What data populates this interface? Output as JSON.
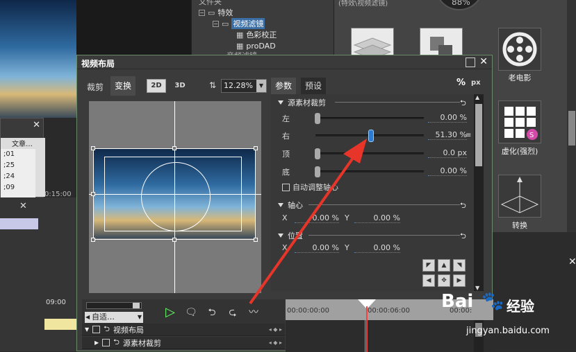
{
  "tree": {
    "root_partial": "文件夹",
    "effects": "特效",
    "video_filters": "视频滤镜",
    "color_correction": "色彩校正",
    "prodad": "proDAD",
    "cut_item": "音频滤镜"
  },
  "right_panel": {
    "header_partial": "(特效\\视频滤镜)",
    "gauge_partial": "88%",
    "tiles": [
      {
        "label": "老电影",
        "icon": "film-reel-icon"
      },
      {
        "label": "虚化(强烈)",
        "icon": "grid-blur-icon"
      },
      {
        "label": "转换",
        "icon": "3d-grid-icon"
      }
    ]
  },
  "small_dialog": {
    "header_partial": "文章…",
    "rows": [
      ";01",
      ";25",
      ";24",
      ";09"
    ]
  },
  "background_timeline": {
    "time1": "0:15:00",
    "time2": "09:00"
  },
  "dialog": {
    "title": "视频布局",
    "left_tabs": {
      "crop": "裁剪",
      "transform": "变换"
    },
    "mode_2d": "2D",
    "mode_3d": "3D",
    "zoom": "12.28%",
    "right_tabs": {
      "params": "参数",
      "preset": "预设"
    },
    "unit_pct": "%",
    "unit_px": "px",
    "source_crop": {
      "title": "源素材裁剪",
      "left_label": "左",
      "left_value": "0.00 %",
      "left_fraction": 0.02,
      "right_label": "右",
      "right_value": "51.30 %",
      "right_fraction": 0.513,
      "top_label": "顶",
      "top_value": "0.0 px",
      "top_fraction": 0.02,
      "bottom_label": "底",
      "bottom_value": "0.00 %",
      "bottom_fraction": 0.02,
      "auto_adjust": "自动调整轴心"
    },
    "pivot": {
      "title": "轴心",
      "x_label": "X",
      "x_value": "0.00 %",
      "y_label": "Y",
      "y_value": "0.00 %"
    },
    "position": {
      "title": "位置",
      "x_label": "X",
      "x_value": "0.00 %",
      "y_label": "Y",
      "y_value": "0.00 %"
    },
    "bottom": {
      "fit_label": "自适…",
      "layer1": "视频布局",
      "layer2": "源素材裁剪",
      "ruler_t0": "00:00:00:00",
      "ruler_t1": "00:00:06:00",
      "ruler_t2": "00:00:"
    }
  },
  "watermark": {
    "brand": "Bai",
    "brand2": "经验",
    "url": "jingyan.baidu.com"
  },
  "colors": {
    "accent_blue": "#3a6ea5",
    "arrow_red": "#e8352a"
  }
}
